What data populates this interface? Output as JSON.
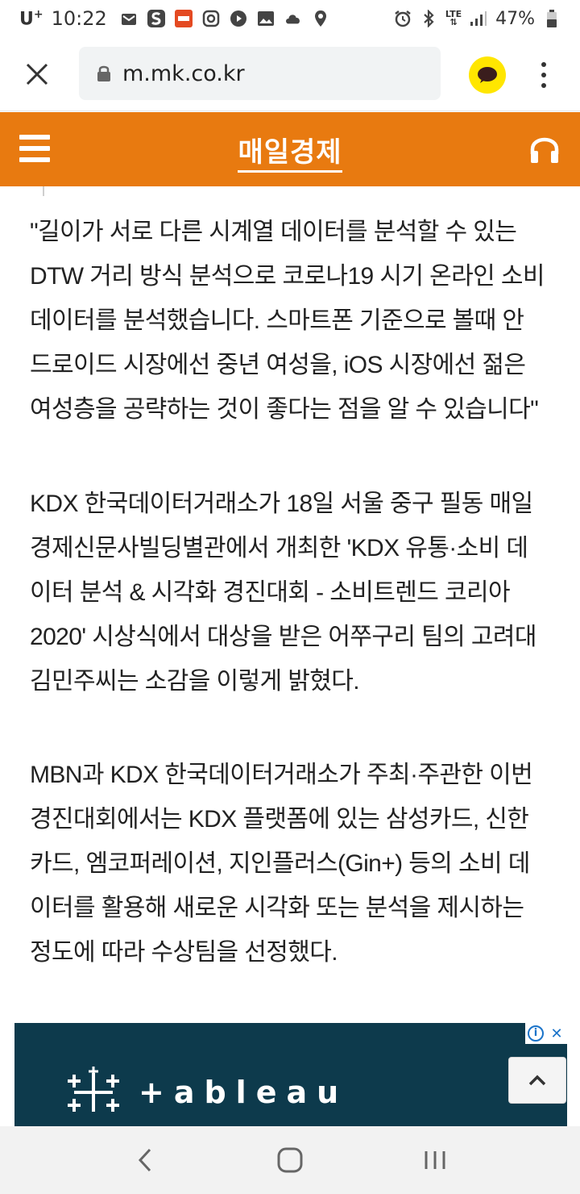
{
  "status_bar": {
    "carrier": "U",
    "carrier_sup": "+",
    "time": "10:22",
    "network": "LTE",
    "battery": "47%"
  },
  "browser": {
    "url": "m.mk.co.kr"
  },
  "header": {
    "logo": "매일경제"
  },
  "article": {
    "paragraphs": [
      "\"길이가 서로 다른 시계열 데이터를 분석할 수 있는\nDTW 거리 방식 분석으로 코로나19 시기 온라인 소비\n데이터를 분석했습니다. 스마트폰 기준으로 볼때 안\n드로이드 시장에선 중년 여성을, iOS 시장에선 젊은\n여성층을 공략하는 것이 좋다는 점을 알 수 있습니다\"",
      "KDX 한국데이터거래소가 18일 서울 중구 필동 매일\n경제신문사빌딩별관에서 개최한 'KDX 유통·소비 데\n이터 분석 & 시각화 경진대회 - 소비트렌드 코리아\n2020' 시상식에서 대상을 받은 어쭈구리 팀의 고려대\n김민주씨는 소감을 이렇게 밝혔다.",
      "MBN과 KDX 한국데이터거래소가 주최·주관한 이번\n경진대회에서는 KDX 플랫폼에 있는 삼성카드, 신한\n카드, 엠코퍼레이션, 지인플러스(Gin+) 등의 소비 데\n이터를 활용해 새로운 시각화 또는 분석을 제시하는\n정도에 따라 수상팀을 선정했다."
    ]
  },
  "ad": {
    "brand": "+ableau",
    "info": "i",
    "close": "✕"
  },
  "colors": {
    "header_bg": "#e87a10",
    "kakao": "#ffe600",
    "ad_bg": "#0d3a4c"
  }
}
